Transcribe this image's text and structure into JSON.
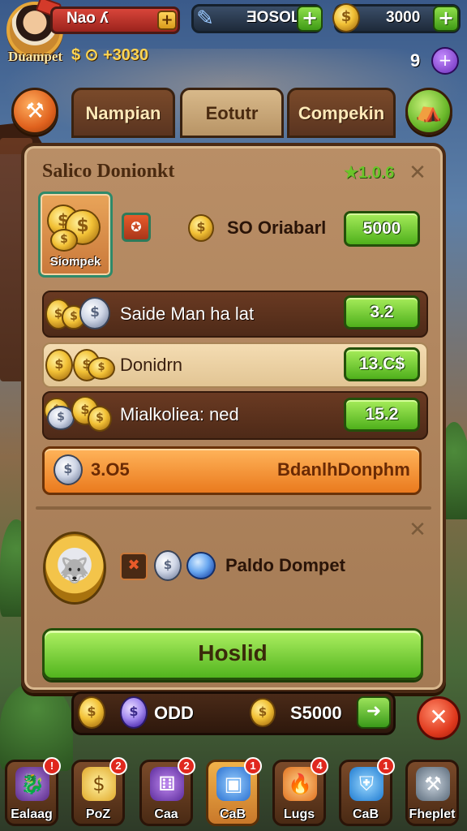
{
  "header": {
    "player_name": "Nao ʎ",
    "player_label": "Duampet",
    "coins_display": "$ ⊙ +3030",
    "resources": [
      {
        "value": "ƎOSOL",
        "icon": "pen-icon"
      },
      {
        "value": "3000",
        "icon": "money-bag-icon"
      }
    ],
    "gem_count": "9"
  },
  "tabs": [
    {
      "label": "Nampian",
      "active": false
    },
    {
      "label": "Eotutr",
      "active": true
    },
    {
      "label": "Compekin",
      "active": false
    }
  ],
  "panel": {
    "title": "Salico Donionkt",
    "stat": "★1.0.6",
    "bag_label": "Siompek",
    "top_row": {
      "label": "SO Oriabarl",
      "value": "5000"
    },
    "rows": [
      {
        "label": "Saide Man ha lat",
        "value": "3.2",
        "style": "dark"
      },
      {
        "label": "Donidrn",
        "value": "13.C$",
        "style": "light"
      },
      {
        "label": "Mialkoliea: ned",
        "value": "15.2",
        "style": "dark"
      }
    ],
    "orange_bar": {
      "left_text": "3.O5",
      "right_text": "BdanlhDonphm"
    },
    "section2_label": "Paldo Dompet",
    "confirm_label": "Hoslid"
  },
  "summary": {
    "left_text": "ODD",
    "right_text": "S5000"
  },
  "nav": [
    {
      "label": "Ealaag",
      "badge": "!",
      "icon": "dragon-icon",
      "color": "#8a5ab8"
    },
    {
      "label": "PoZ",
      "badge": "2",
      "icon": "coin-icon",
      "color": "#e8b23a"
    },
    {
      "label": "Caa",
      "badge": "2",
      "icon": "dice-icon",
      "color": "#7a3ab8"
    },
    {
      "label": "CaB",
      "badge": "1",
      "icon": "box-icon",
      "color": "#3a8ae0",
      "active": true
    },
    {
      "label": "Lugs",
      "badge": "4",
      "icon": "fire-icon",
      "color": "#f08a2a"
    },
    {
      "label": "CaB",
      "badge": "1",
      "icon": "shield-icon",
      "color": "#2a8ae0"
    },
    {
      "label": "Fheplet",
      "badge": "",
      "icon": "hammer-icon",
      "color": "#6a7a8a"
    }
  ]
}
